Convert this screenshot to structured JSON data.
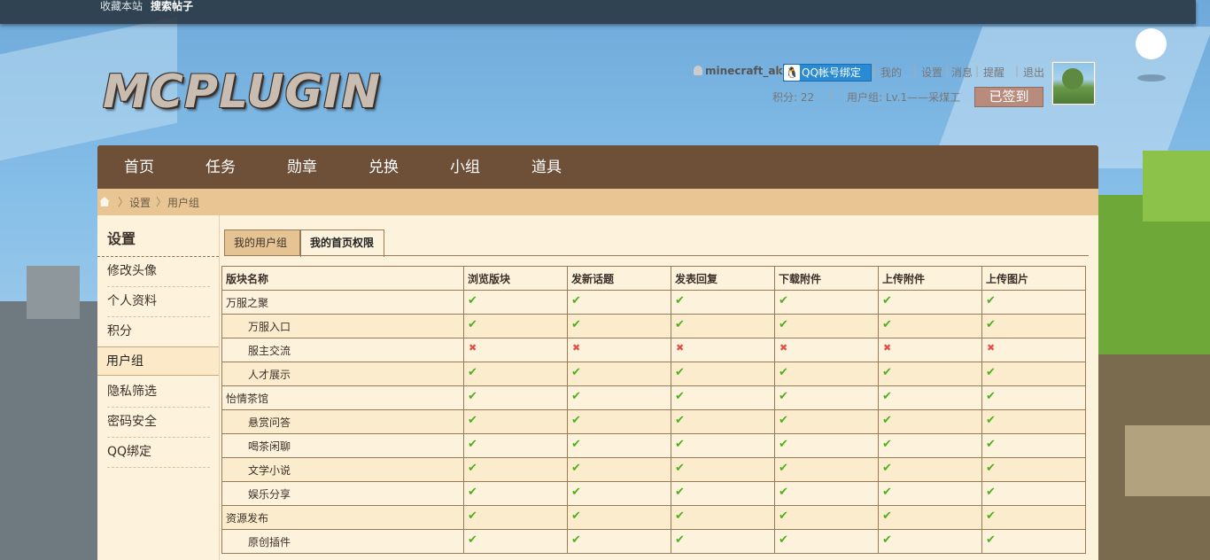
{
  "topbar": {
    "bookmark": "收藏本站",
    "search_posts": "搜索帖子"
  },
  "logo": {
    "text": "MCPLUGIN"
  },
  "user": {
    "name": "minecraft_ak",
    "qq_bind": "QQ帐号绑定",
    "links": [
      "我的",
      "设置",
      "消息",
      "提醒",
      "退出"
    ],
    "points": "积分: 22",
    "group": "用户组: Lv.1——采煤工",
    "signed": "已签到"
  },
  "nav": [
    "首页",
    "任务",
    "勋章",
    "兑换",
    "小组",
    "道具"
  ],
  "breadcrumb": [
    "设置",
    "用户组"
  ],
  "sidebar": {
    "title": "设置",
    "items": [
      "修改头像",
      "个人资料",
      "积分",
      "用户组",
      "隐私筛选",
      "密码安全",
      "QQ绑定"
    ]
  },
  "tabs": [
    "我的用户组",
    "我的首页权限"
  ],
  "table": {
    "headers": [
      "版块名称",
      "浏览版块",
      "发新话题",
      "发表回复",
      "下载附件",
      "上传附件",
      "上传图片"
    ],
    "rows": [
      {
        "name": "万服之聚",
        "sub": false,
        "perms": [
          true,
          true,
          true,
          true,
          true,
          true
        ]
      },
      {
        "name": "万服入口",
        "sub": true,
        "perms": [
          true,
          true,
          true,
          true,
          true,
          true
        ]
      },
      {
        "name": "服主交流",
        "sub": true,
        "perms": [
          false,
          false,
          false,
          false,
          false,
          false
        ]
      },
      {
        "name": "人才展示",
        "sub": true,
        "perms": [
          true,
          true,
          true,
          true,
          true,
          true
        ]
      },
      {
        "name": "怡情茶馆",
        "sub": false,
        "perms": [
          true,
          true,
          true,
          true,
          true,
          true
        ]
      },
      {
        "name": "悬赏问答",
        "sub": true,
        "perms": [
          true,
          true,
          true,
          true,
          true,
          true
        ]
      },
      {
        "name": "喝茶闲聊",
        "sub": true,
        "perms": [
          true,
          true,
          true,
          true,
          true,
          true
        ]
      },
      {
        "name": "文学小说",
        "sub": true,
        "perms": [
          true,
          true,
          true,
          true,
          true,
          true
        ]
      },
      {
        "name": "娱乐分享",
        "sub": true,
        "perms": [
          true,
          true,
          true,
          true,
          true,
          true
        ]
      },
      {
        "name": "资源发布",
        "sub": false,
        "perms": [
          true,
          true,
          true,
          true,
          true,
          true
        ]
      },
      {
        "name": "原创插件",
        "sub": true,
        "perms": [
          true,
          true,
          true,
          true,
          true,
          true
        ]
      }
    ]
  },
  "colors": {
    "nav_bg": "#6e4f38",
    "crumb_bg": "#e8c592",
    "check": "#4fae1e",
    "cross": "#e2504a"
  }
}
